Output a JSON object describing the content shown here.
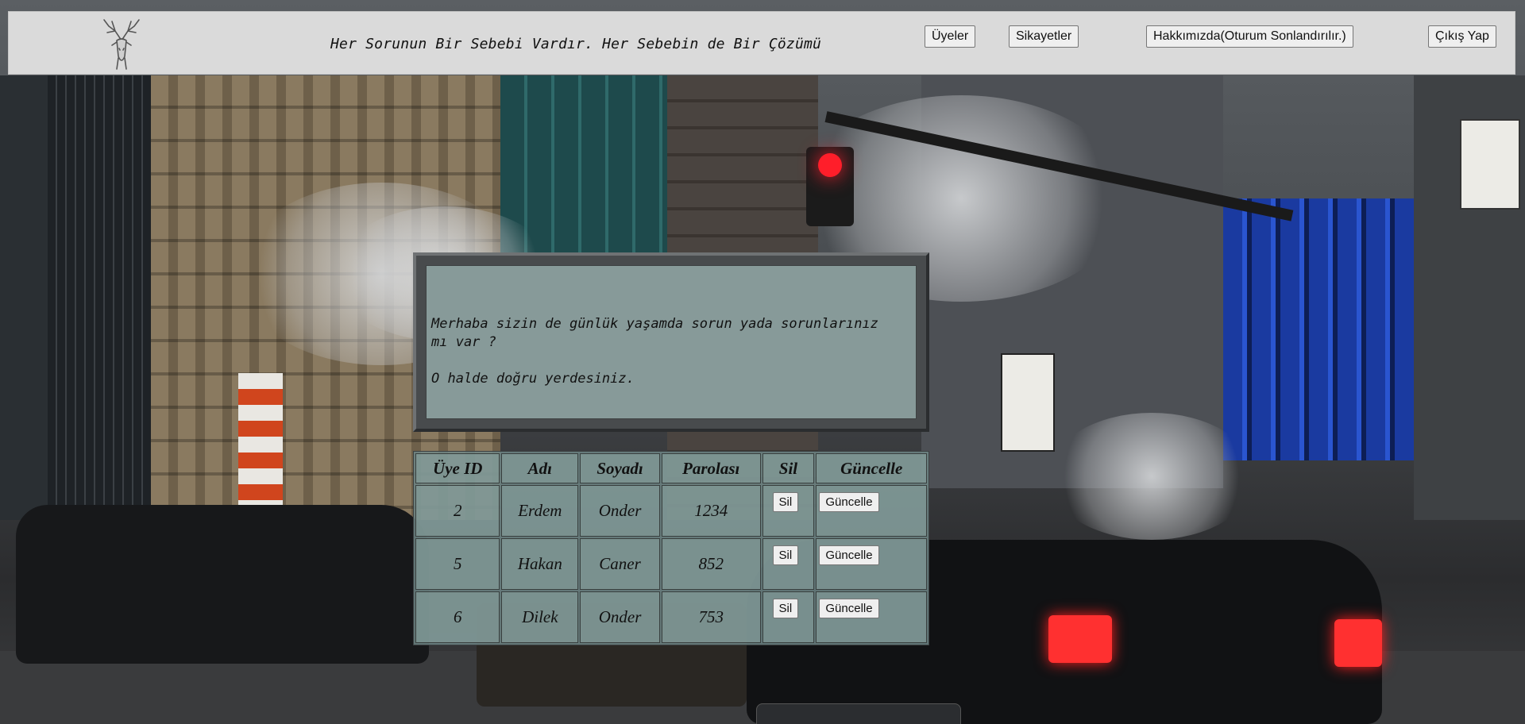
{
  "header": {
    "tagline": "Her Sorunun Bir Sebebi Vardır. Her Sebebin de Bir Çözümü",
    "nav": {
      "members": "Üyeler",
      "complaints": "Sikayetler",
      "about": "Hakkımızda(Oturum Sonlandırılır.)",
      "logout": "Çıkış Yap"
    }
  },
  "message": {
    "line1": "Merhaba sizin de günlük yaşamda sorun yada sorunlarınız",
    "line2": "mı var ?",
    "line3": "O halde doğru yerdesiniz."
  },
  "table": {
    "headers": {
      "id": "Üye ID",
      "name": "Adı",
      "surname": "Soyadı",
      "password": "Parolası",
      "delete": "Sil",
      "update": "Güncelle"
    },
    "rows": [
      {
        "id": "2",
        "name": "Erdem",
        "surname": "Onder",
        "password": "1234",
        "delete_label": "Sil",
        "update_label": "Güncelle"
      },
      {
        "id": "5",
        "name": "Hakan",
        "surname": "Caner",
        "password": "852",
        "delete_label": "Sil",
        "update_label": "Güncelle"
      },
      {
        "id": "6",
        "name": "Dilek",
        "surname": "Onder",
        "password": "753",
        "delete_label": "Sil",
        "update_label": "Güncelle"
      }
    ]
  },
  "colors": {
    "header_bg": "#dadada",
    "panel_frame": "#484b4d",
    "panel_fill": "#91a8a5",
    "table_fill": "#6e8686"
  }
}
